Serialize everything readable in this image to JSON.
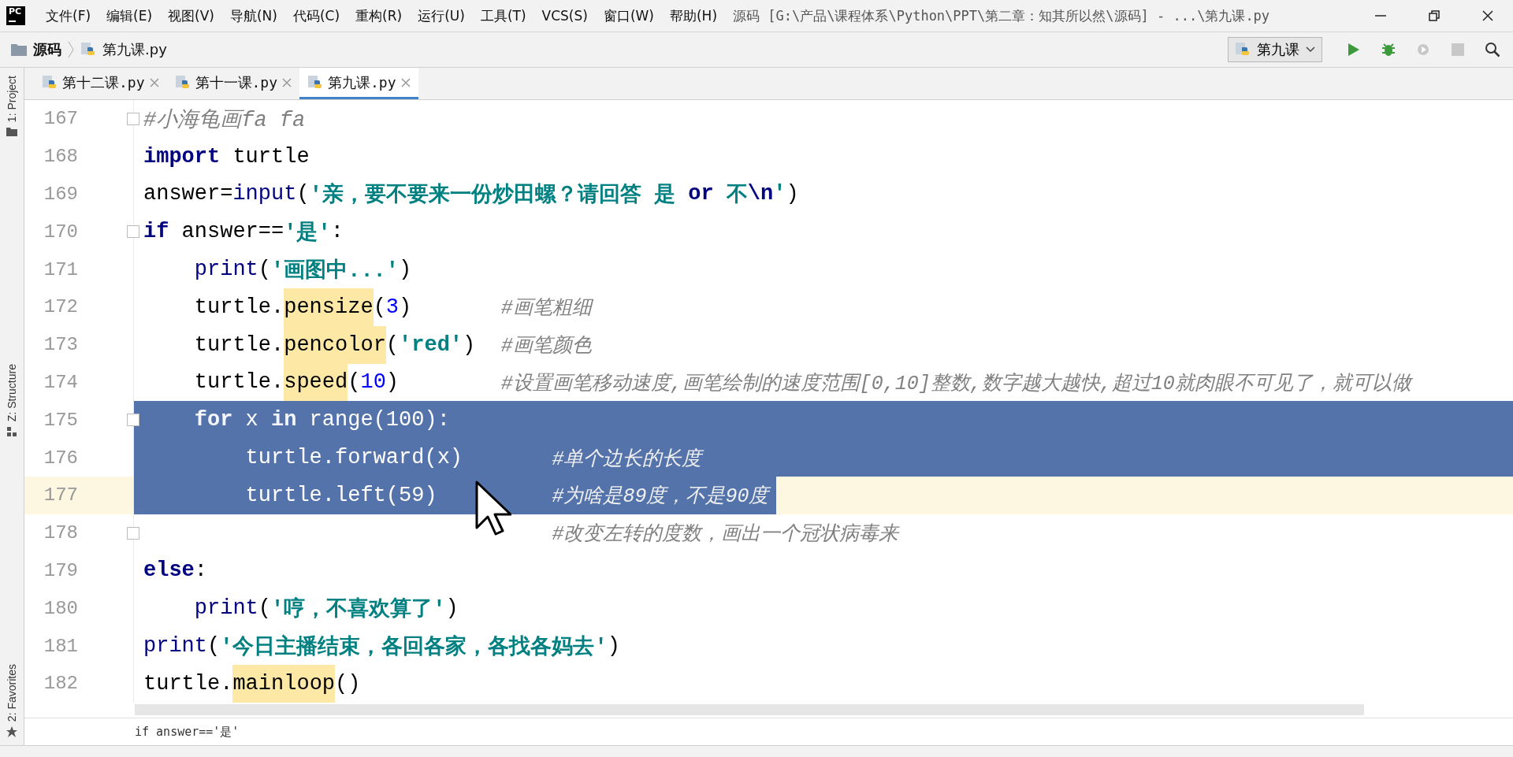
{
  "menu": [
    "文件(F)",
    "编辑(E)",
    "视图(V)",
    "导航(N)",
    "代码(C)",
    "重构(R)",
    "运行(U)",
    "工具(T)",
    "VCS(S)",
    "窗口(W)",
    "帮助(H)"
  ],
  "logo_text": "PC",
  "window": {
    "title": "源码 [G:\\产品\\课程体系\\Python\\PPT\\第二章：知其所以然\\源码] - ...\\第九课.py"
  },
  "breadcrumb": [
    "源码",
    "第九课.py"
  ],
  "run_config": "第九课",
  "tabs": [
    {
      "label": "第十二课.py",
      "selected": false
    },
    {
      "label": "第十一课.py",
      "selected": false
    },
    {
      "label": "第九课.py",
      "selected": true
    }
  ],
  "tool_windows": [
    {
      "label": "1: Project",
      "kind": "folder"
    },
    {
      "label": "Z: Structure",
      "kind": "structure"
    },
    {
      "label": "2: Favorites",
      "kind": "star"
    }
  ],
  "lines": [
    {
      "number": "167",
      "fold": true,
      "selected": false,
      "current": false,
      "code": [
        {
          "kind": "comment",
          "text": "#小海龟画fa fa"
        }
      ]
    },
    {
      "number": "168",
      "fold": false,
      "selected": false,
      "current": false,
      "code": [
        {
          "kind": "keyword",
          "text": "import"
        },
        {
          "kind": "plain",
          "text": " turtle"
        }
      ]
    },
    {
      "number": "169",
      "fold": false,
      "selected": false,
      "current": false,
      "code": [
        {
          "kind": "plain",
          "text": "answer="
        },
        {
          "kind": "builtin",
          "text": "input"
        },
        {
          "kind": "plain",
          "text": "("
        },
        {
          "kind": "string",
          "text": "'亲，要不要来一份炒田螺？请回答 是 "
        },
        {
          "kind": "keyword",
          "text": "or"
        },
        {
          "kind": "string",
          "text": " 不"
        },
        {
          "kind": "escape",
          "text": "\\n"
        },
        {
          "kind": "string",
          "text": "'"
        },
        {
          "kind": "plain",
          "text": ")"
        }
      ]
    },
    {
      "number": "170",
      "fold": true,
      "selected": false,
      "current": false,
      "code": [
        {
          "kind": "keyword",
          "text": "if"
        },
        {
          "kind": "plain",
          "text": " answer=="
        },
        {
          "kind": "string",
          "text": "'是'"
        },
        {
          "kind": "plain",
          "text": ":"
        }
      ],
      "children": [
        {
          "number": "171",
          "fold": false,
          "selected": false,
          "current": false,
          "code": [
            {
              "kind": "builtin",
              "text": "print"
            },
            {
              "kind": "plain",
              "text": "("
            },
            {
              "kind": "string",
              "text": "'画图中...'"
            },
            {
              "kind": "plain",
              "text": ")"
            }
          ]
        },
        {
          "number": "172",
          "fold": false,
          "selected": false,
          "current": false,
          "code": [
            {
              "kind": "plain",
              "text": "turtle."
            },
            {
              "kind": "call",
              "text": "pensize"
            },
            {
              "kind": "plain",
              "text": "("
            },
            {
              "kind": "number",
              "text": "3"
            },
            {
              "kind": "plain",
              "text": ")"
            }
          ],
          "comment": "#画笔粗细"
        },
        {
          "number": "173",
          "fold": false,
          "selected": false,
          "current": false,
          "code": [
            {
              "kind": "plain",
              "text": "turtle."
            },
            {
              "kind": "call",
              "text": "pencolor"
            },
            {
              "kind": "plain",
              "text": "("
            },
            {
              "kind": "string",
              "text": "'red'"
            },
            {
              "kind": "plain",
              "text": ")"
            }
          ],
          "comment": "#画笔颜色"
        },
        {
          "number": "174",
          "fold": false,
          "selected": false,
          "current": false,
          "code": [
            {
              "kind": "plain",
              "text": "turtle."
            },
            {
              "kind": "call",
              "text": "speed"
            },
            {
              "kind": "plain",
              "text": "("
            },
            {
              "kind": "number",
              "text": "10"
            },
            {
              "kind": "plain",
              "text": ")"
            }
          ],
          "comment": "#设置画笔移动速度,画笔绘制的速度范围[0,10]整数,数字越大越快,超过10就肉眼不可见了，就可以做"
        },
        {
          "number": "175",
          "fold": true,
          "selected": true,
          "current": false,
          "code": [
            {
              "kind": "keyword",
              "text": "for"
            },
            {
              "kind": "plain",
              "text": " x "
            },
            {
              "kind": "keyword",
              "text": "in"
            },
            {
              "kind": "plain",
              "text": " range(100):"
            }
          ],
          "children": [
            {
              "number": "176",
              "fold": false,
              "selected": true,
              "current": false,
              "code": [
                {
                  "text": "turtle.forward(x)"
                }
              ],
              "comment": "#单个边长的长度"
            },
            {
              "number": "177",
              "fold": false,
              "selected": true,
              "current": true,
              "code": [
                {
                  "text": "turtle.left(59)"
                }
              ],
              "comment": "#为啥是89度，不是90度"
            },
            {
              "number": "178",
              "fold": true,
              "selected": false,
              "current": false,
              "comment": "#改变左转的度数，画出一个冠状病毒来"
            }
          ]
        }
      ]
    },
    {
      "number": "179",
      "fold": false,
      "selected": false,
      "current": false,
      "code": [
        {
          "kind": "keyword",
          "text": "else"
        },
        {
          "kind": "plain",
          "text": ":"
        }
      ],
      "children": [
        {
          "number": "180",
          "fold": false,
          "selected": false,
          "current": false,
          "code": [
            {
              "kind": "builtin",
              "text": "print"
            },
            {
              "kind": "plain",
              "text": "("
            },
            {
              "kind": "string",
              "text": "'哼，不喜欢算了'"
            },
            {
              "kind": "plain",
              "text": ")"
            }
          ]
        }
      ]
    },
    {
      "number": "181",
      "fold": false,
      "selected": false,
      "current": false,
      "code": [
        {
          "kind": "builtin",
          "text": "print"
        },
        {
          "kind": "plain",
          "text": "("
        },
        {
          "kind": "string",
          "text": "'今日主播结束，各回各家，各找各妈去'"
        },
        {
          "kind": "plain",
          "text": ")"
        }
      ]
    },
    {
      "number": "182",
      "fold": false,
      "selected": false,
      "current": false,
      "code": [
        {
          "kind": "plain",
          "text": "turtle."
        },
        {
          "kind": "call",
          "text": "mainloop"
        },
        {
          "kind": "plain",
          "text": "()"
        }
      ]
    }
  ],
  "code_breadcrumb": "if answer=='是'"
}
